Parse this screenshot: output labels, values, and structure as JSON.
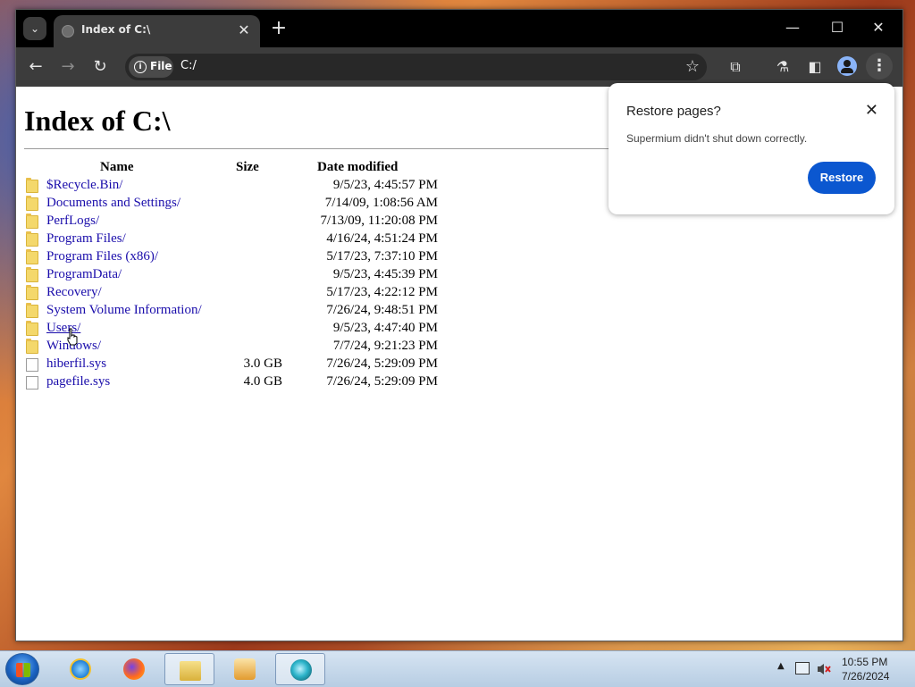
{
  "tab": {
    "title": "Index of C:\\",
    "close_symbol": "✕",
    "list_symbol": "⌄",
    "new_symbol": "+"
  },
  "window_controls": {
    "minimize": "—",
    "maximize": "☐",
    "close": "✕"
  },
  "toolbar": {
    "back": "←",
    "forward": "→",
    "reload": "↻",
    "site_chip": "File",
    "url": "C:/",
    "bookmark": "☆",
    "extensions": "⧉",
    "labs": "⚗",
    "side_panel": "◧",
    "menu": "⋮"
  },
  "page": {
    "title": "Index of C:\\",
    "columns": {
      "name": "Name",
      "size": "Size",
      "date": "Date modified"
    },
    "rows": [
      {
        "name": "$Recycle.Bin/",
        "size": "",
        "date": "9/5/23, 4:45:57 PM",
        "type": "folder"
      },
      {
        "name": "Documents and Settings/",
        "size": "",
        "date": "7/14/09, 1:08:56 AM",
        "type": "folder"
      },
      {
        "name": "PerfLogs/",
        "size": "",
        "date": "7/13/09, 11:20:08 PM",
        "type": "folder"
      },
      {
        "name": "Program Files/",
        "size": "",
        "date": "4/16/24, 4:51:24 PM",
        "type": "folder"
      },
      {
        "name": "Program Files (x86)/",
        "size": "",
        "date": "5/17/23, 7:37:10 PM",
        "type": "folder"
      },
      {
        "name": "ProgramData/",
        "size": "",
        "date": "9/5/23, 4:45:39 PM",
        "type": "folder"
      },
      {
        "name": "Recovery/",
        "size": "",
        "date": "5/17/23, 4:22:12 PM",
        "type": "folder"
      },
      {
        "name": "System Volume Information/",
        "size": "",
        "date": "7/26/24, 9:48:51 PM",
        "type": "folder"
      },
      {
        "name": "Users/",
        "size": "",
        "date": "9/5/23, 4:47:40 PM",
        "type": "folder"
      },
      {
        "name": "Windows/",
        "size": "",
        "date": "7/7/24, 9:21:23 PM",
        "type": "folder"
      },
      {
        "name": "hiberfil.sys",
        "size": "3.0 GB",
        "date": "7/26/24, 5:29:09 PM",
        "type": "file"
      },
      {
        "name": "pagefile.sys",
        "size": "4.0 GB",
        "date": "7/26/24, 5:29:09 PM",
        "type": "file"
      }
    ]
  },
  "popup": {
    "title": "Restore pages?",
    "message": "Supermium didn't shut down correctly.",
    "close_symbol": "✕",
    "button": "Restore"
  },
  "taskbar": {
    "items": [
      "internet-explorer",
      "firefox",
      "file-explorer",
      "media-player",
      "supermium"
    ],
    "tray_arrow": "▲",
    "time": "10:55 PM",
    "date": "7/26/2024"
  },
  "colors": {
    "accent": "#0b57d0",
    "link": "#1a0dab",
    "titlebar": "#000000",
    "toolbar": "#3c3c3c"
  }
}
